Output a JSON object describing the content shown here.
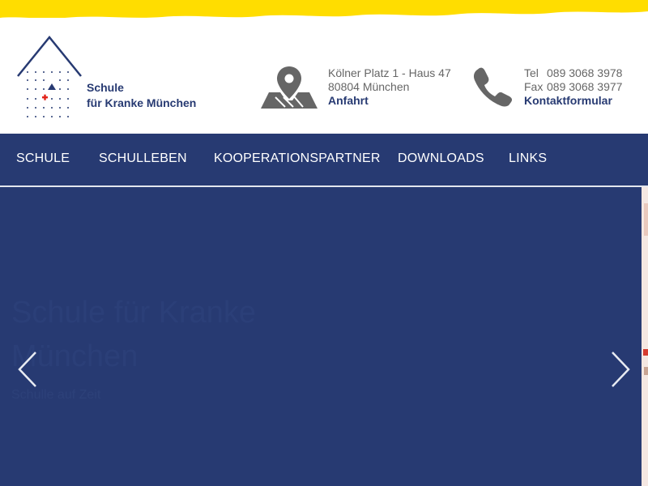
{
  "brand": {
    "name_line1": "Schule",
    "name_line2": "für Kranke München",
    "primary_color": "#273a72",
    "accent_color": "#ffdd00",
    "cross_color": "#e2231a"
  },
  "address": {
    "icon": "map-location-icon",
    "line1": "Kölner Platz 1 - Haus 47",
    "line2": "80804 München",
    "link": "Anfahrt"
  },
  "contact": {
    "icon": "phone-icon",
    "tel_label": "Tel",
    "tel": "089 3068 3978",
    "fax_label": "Fax",
    "fax": "089 3068 3977",
    "link": "Kontaktformular"
  },
  "nav": {
    "items": [
      {
        "label": "SCHULE"
      },
      {
        "label": "SCHULLEBEN"
      },
      {
        "label": "KOOPERATIONSPARTNER"
      },
      {
        "label": "DOWNLOADS"
      },
      {
        "label": "LINKS"
      }
    ]
  },
  "hero": {
    "title": "Schule für Kranke München",
    "subtitle": "Schulle auf Zeit",
    "prev_icon": "chevron-left-icon",
    "next_icon": "chevron-right-icon"
  }
}
